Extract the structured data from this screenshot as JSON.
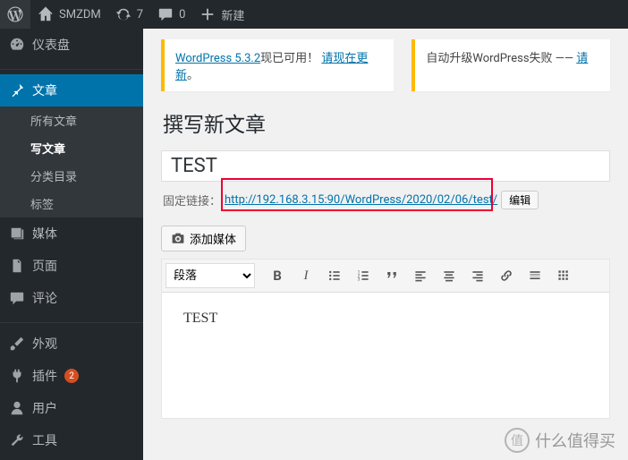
{
  "adminbar": {
    "site_name": "SMZDM",
    "updates_count": "7",
    "comments_count": "0",
    "new_label": "新建"
  },
  "sidebar": {
    "dashboard": "仪表盘",
    "posts": "文章",
    "posts_sub": {
      "all": "所有文章",
      "new": "写文章",
      "categories": "分类目录",
      "tags": "标签"
    },
    "media": "媒体",
    "pages": "页面",
    "comments": "评论",
    "appearance": "外观",
    "plugins": "插件",
    "plugins_badge": "2",
    "users": "用户",
    "tools": "工具"
  },
  "notices": {
    "update_prefix": "WordPress 5.3.2",
    "update_mid": "现已可用！",
    "update_link": "请现在更新",
    "update_suffix": "。",
    "upgrade_fail": "自动升级WordPress失败 —— ",
    "upgrade_link": "请"
  },
  "page": {
    "title": "撰写新文章",
    "post_title": "TEST",
    "permalink_label": "固定链接：",
    "permalink_url": "http://192.168.3.15:90/WordPress/2020/02/06/test/",
    "edit_btn": "编辑",
    "add_media": "添加媒体",
    "format_select": "段落",
    "body_text": "TEST"
  },
  "watermark": {
    "logo": "值",
    "text": "什么值得买"
  }
}
